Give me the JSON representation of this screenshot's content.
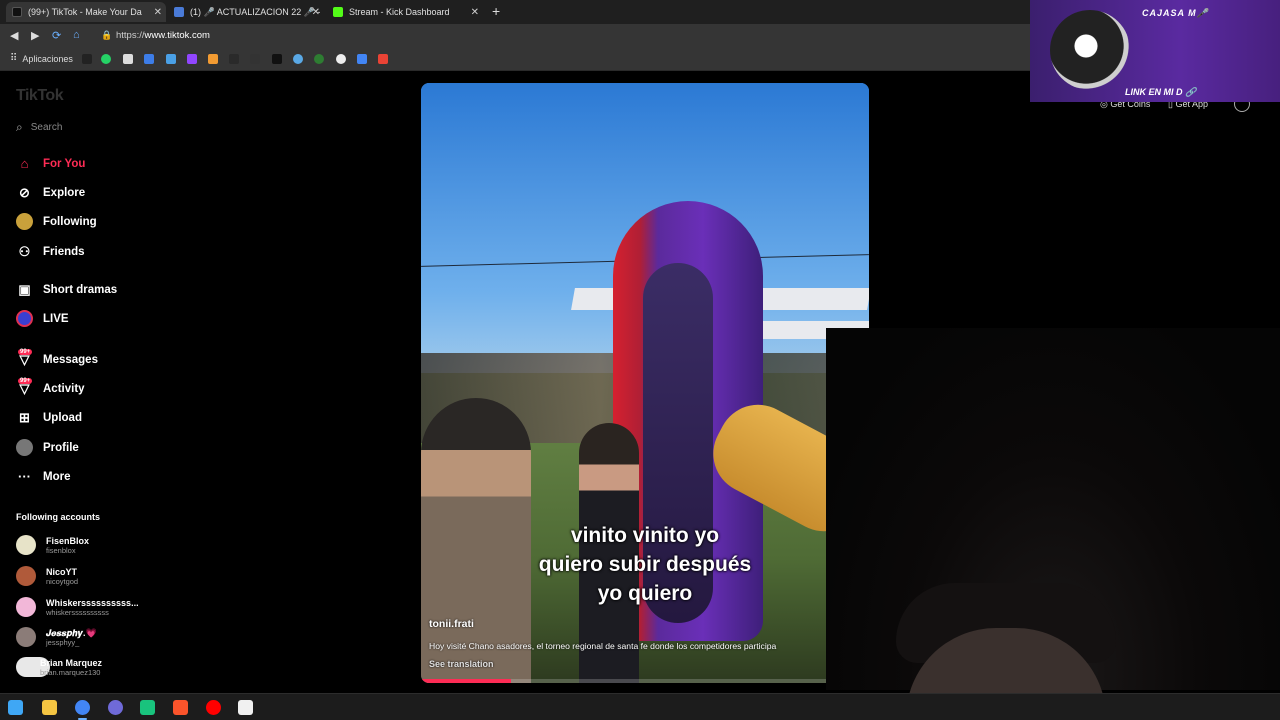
{
  "browser": {
    "tabs": [
      {
        "title": "(99+) TikTok - Make Your Da",
        "active": true,
        "icon": "tiktok-icon",
        "color": "#ffffff"
      },
      {
        "title": "(1) 🎤 ACTUALIZACION 22 🎤 -",
        "active": false,
        "icon": "roblox-icon",
        "color": "#4a7bd8"
      },
      {
        "title": "Stream - Kick Dashboard",
        "active": false,
        "icon": "kick-icon",
        "color": "#53fc18"
      }
    ],
    "new_tab": "+",
    "url_prefix": "https://",
    "url_host": "www.tiktok.com",
    "bookmarks_label": "Aplicaciones"
  },
  "tiktok": {
    "logo": "TikTok",
    "search_placeholder": "Search",
    "nav": [
      {
        "label": "For You",
        "icon": "home-icon",
        "active": true
      },
      {
        "label": "Explore",
        "icon": "compass-icon",
        "active": false
      },
      {
        "label": "Following",
        "icon": "following-avatar-icon",
        "active": false
      },
      {
        "label": "Friends",
        "icon": "friends-icon",
        "active": false
      },
      {
        "label": "Short dramas",
        "icon": "short-dramas-icon",
        "active": false
      },
      {
        "label": "LIVE",
        "icon": "live-icon",
        "active": false
      },
      {
        "label": "Messages",
        "icon": "messages-icon",
        "active": false,
        "badge": "99+"
      },
      {
        "label": "Activity",
        "icon": "activity-icon",
        "active": false,
        "badge": "99+"
      },
      {
        "label": "Upload",
        "icon": "upload-icon",
        "active": false
      },
      {
        "label": "Profile",
        "icon": "profile-icon",
        "active": false
      },
      {
        "label": "More",
        "icon": "more-icon",
        "active": false
      }
    ],
    "following_heading": "Following accounts",
    "following": [
      {
        "name": "FisenBlox",
        "handle": "fisenblox",
        "color": "#e7e3c8"
      },
      {
        "name": "NicoYT",
        "handle": "nicoytgod",
        "color": "#b05a3a"
      },
      {
        "name": "Whiskerssssssssss...",
        "handle": "whiskerssssssssss",
        "color": "#f2b7d8"
      },
      {
        "name": "𝑱𝒆𝒔𝒔𝒑𝒉𝒚.💗",
        "handle": "jessphyy_",
        "color": "#8b7c78"
      },
      {
        "name": "Brian Marquez",
        "handle": "brian.marquez130",
        "color": "#e8e8e8"
      }
    ],
    "get_coins": "Get Coins",
    "get_app": "Get App",
    "video": {
      "caption_lines": [
        "vinito vinito yo",
        "quiero subir después",
        "yo quiero"
      ],
      "author": "tonii.frati",
      "description": "Hoy visité Chano asadores, el torneo regional de santa fe donde los competidores participa",
      "see_translation": "See translation",
      "progress": 0.2
    }
  },
  "stream_overlay": {
    "title": "CAJASA M🎤",
    "link": "LINK EN MI D 🔗"
  },
  "taskbar": {
    "icons": [
      {
        "name": "windows-start-icon",
        "color": "#3fa7f5"
      },
      {
        "name": "file-explorer-icon",
        "color": "#f5c542"
      },
      {
        "name": "chrome-icon",
        "color": "#4285f4"
      },
      {
        "name": "chrome-profile-icon",
        "color": "#6f6ad8"
      },
      {
        "name": "chatgpt-icon",
        "color": "#19c37d"
      },
      {
        "name": "brave-icon",
        "color": "#fb542b"
      },
      {
        "name": "youtube-icon",
        "color": "#ff0000"
      },
      {
        "name": "capcut-icon",
        "color": "#f0f0f0"
      }
    ]
  }
}
